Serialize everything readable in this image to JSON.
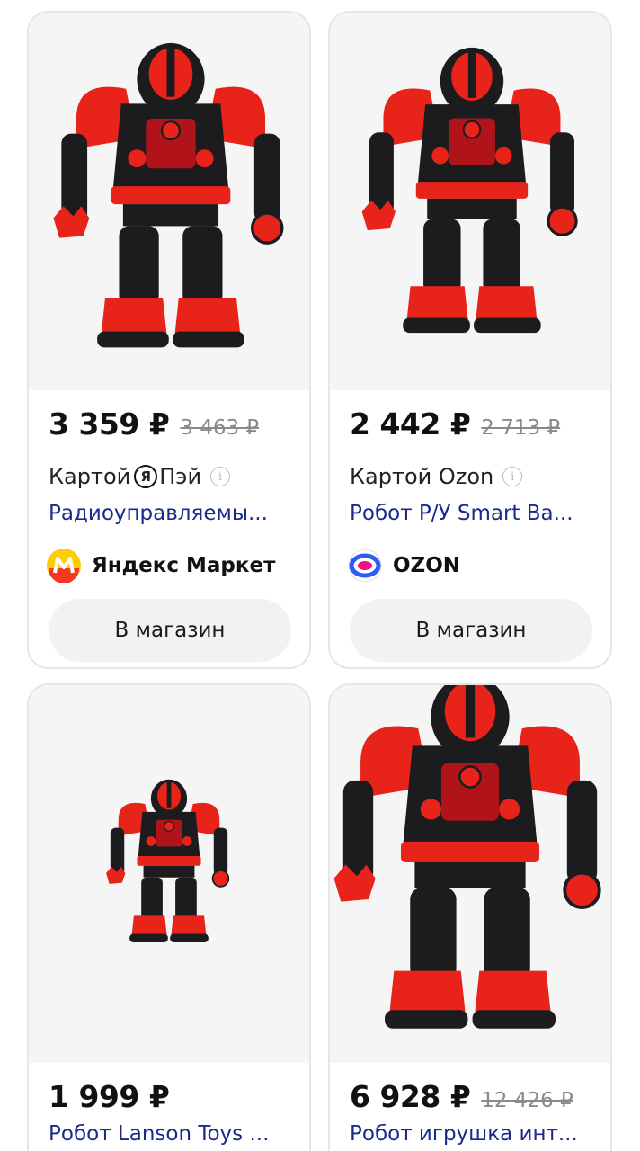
{
  "products": [
    {
      "price": "3 359 ₽",
      "old_price": "3 463 ₽",
      "pay_prefix": "Картой",
      "pay_logo_letter": "Я",
      "pay_suffix": "Пэй",
      "title": "Радиоуправляемы...",
      "shop": "Яндекс Маркет",
      "shop_icon": "yandex-market-icon",
      "button": "В магазин"
    },
    {
      "price": "2 442 ₽",
      "old_price": "2 713 ₽",
      "pay_prefix": "Картой Ozon",
      "title": "Робот Р/У Smart Ba...",
      "shop": "OZON",
      "shop_icon": "ozon-icon",
      "button": "В магазин"
    },
    {
      "price": "1 999 ₽",
      "title": "Робот Lanson Toys ..."
    },
    {
      "price": "6 928 ₽",
      "old_price": "12 426 ₽",
      "title": "Робот игрушка инт..."
    }
  ],
  "colors": {
    "link": "#1a2a8c",
    "robot_red": "#e8231a",
    "robot_black": "#1c1c1f",
    "yandex_market_yellow": "#ffcc00",
    "yandex_market_red": "#f33a1f",
    "ozon_blue": "#2b5df4",
    "ozon_pink": "#f1117e"
  }
}
